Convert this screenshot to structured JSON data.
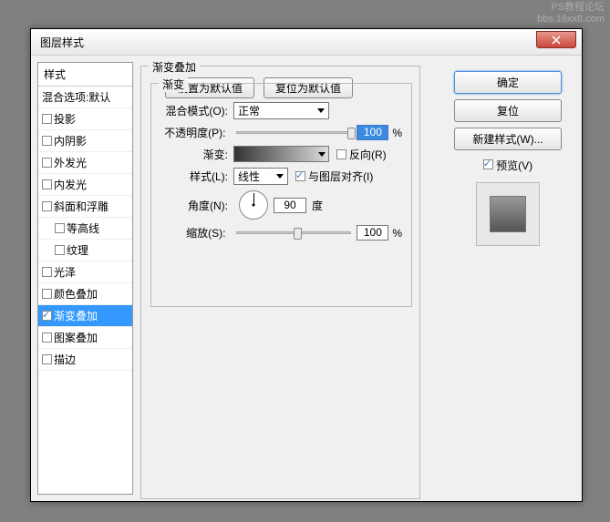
{
  "watermark": {
    "l1": "PS教程论坛",
    "l2": "bbs.16xx8.com"
  },
  "title": "图层样式",
  "sidebar": {
    "header": "样式",
    "items": [
      {
        "label": "混合选项:默认",
        "chk": false,
        "nocheck": true
      },
      {
        "label": "投影",
        "chk": false
      },
      {
        "label": "内阴影",
        "chk": false
      },
      {
        "label": "外发光",
        "chk": false
      },
      {
        "label": "内发光",
        "chk": false
      },
      {
        "label": "斜面和浮雕",
        "chk": false
      },
      {
        "label": "等高线",
        "chk": false,
        "indent": true
      },
      {
        "label": "纹理",
        "chk": false,
        "indent": true
      },
      {
        "label": "光泽",
        "chk": false
      },
      {
        "label": "颜色叠加",
        "chk": false
      },
      {
        "label": "渐变叠加",
        "chk": true,
        "active": true
      },
      {
        "label": "图案叠加",
        "chk": false
      },
      {
        "label": "描边",
        "chk": false
      }
    ]
  },
  "panel": {
    "outer_title": "渐变叠加",
    "inner_title": "渐变",
    "blend_label": "混合模式(O):",
    "blend_value": "正常",
    "opacity_label": "不透明度(P):",
    "opacity_value": "100",
    "opacity_unit": "%",
    "gradient_label": "渐变:",
    "reverse_label": "反向(R)",
    "style_label": "样式(L):",
    "style_value": "线性",
    "align_label": "与图层对齐(I)",
    "angle_label": "角度(N):",
    "angle_value": "90",
    "angle_unit": "度",
    "scale_label": "缩放(S):",
    "scale_value": "100",
    "scale_unit": "%",
    "btn_default": "设置为默认值",
    "btn_reset": "复位为默认值"
  },
  "buttons": {
    "ok": "确定",
    "cancel": "复位",
    "new_style": "新建样式(W)...",
    "preview": "预览(V)"
  }
}
